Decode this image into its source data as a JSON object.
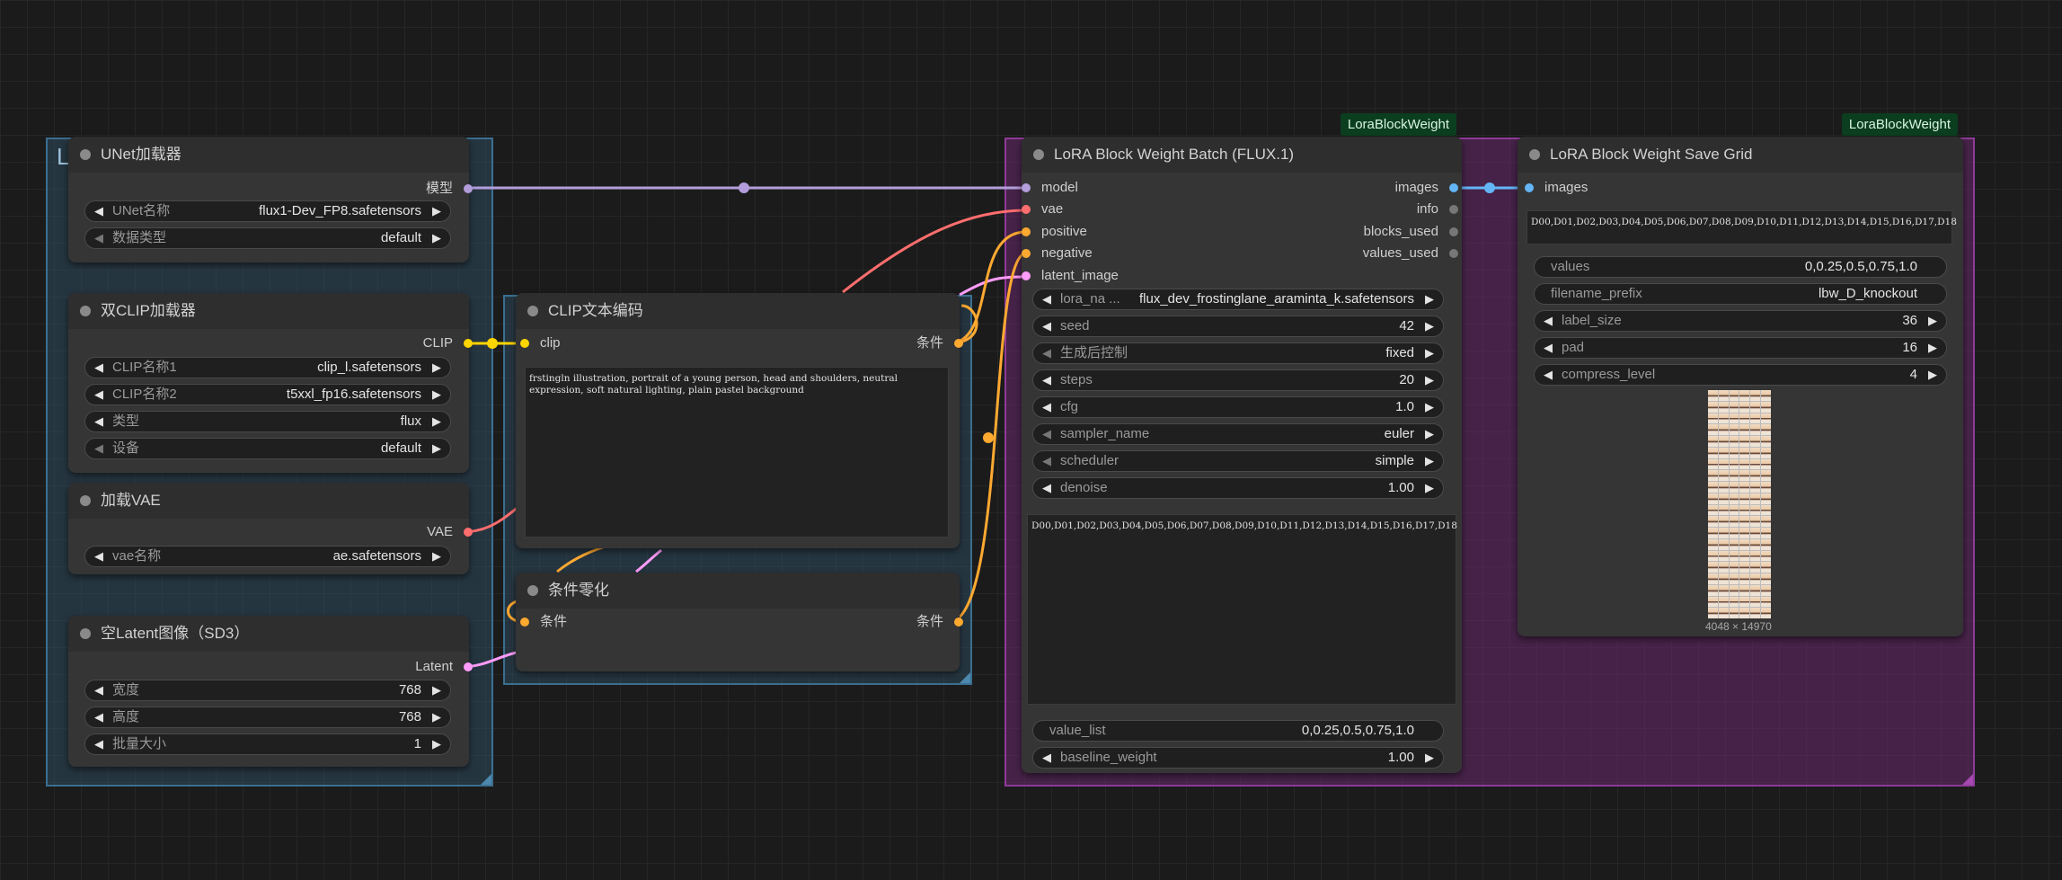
{
  "groups": {
    "left_label": "L"
  },
  "unet_loader": {
    "title": "UNet加载器",
    "out_model": "模型",
    "unet_name": {
      "label": "UNet名称",
      "value": "flux1-Dev_FP8.safetensors"
    },
    "weight_dtype": {
      "label": "数据类型",
      "value": "default"
    }
  },
  "dual_clip": {
    "title": "双CLIP加载器",
    "out_clip": "CLIP",
    "clip_name1": {
      "label": "CLIP名称1",
      "value": "clip_l.safetensors"
    },
    "clip_name2": {
      "label": "CLIP名称2",
      "value": "t5xxl_fp16.safetensors"
    },
    "type": {
      "label": "类型",
      "value": "flux"
    },
    "device": {
      "label": "设备",
      "value": "default"
    }
  },
  "vae_loader": {
    "title": "加载VAE",
    "out_vae": "VAE",
    "vae_name": {
      "label": "vae名称",
      "value": "ae.safetensors"
    }
  },
  "empty_latent": {
    "title": "空Latent图像（SD3）",
    "out_latent": "Latent",
    "width": {
      "label": "宽度",
      "value": "768"
    },
    "height": {
      "label": "高度",
      "value": "768"
    },
    "batch": {
      "label": "批量大小",
      "value": "1"
    }
  },
  "clip_encode": {
    "title": "CLIP文本编码",
    "in_clip": "clip",
    "out_cond": "条件",
    "text": "frstingln illustration, portrait of a young person, head and shoulders, neutral expression, soft natural lighting, plain pastel background"
  },
  "cond_zero": {
    "title": "条件零化",
    "in_cond": "条件",
    "out_cond": "条件"
  },
  "lbw_batch": {
    "badge": "LoraBlockWeight",
    "title": "LoRA Block Weight Batch (FLUX.1)",
    "inputs": [
      "model",
      "vae",
      "positive",
      "negative",
      "latent_image"
    ],
    "outputs": [
      "images",
      "info",
      "blocks_used",
      "values_used"
    ],
    "lora_name": {
      "label": "lora_na ...",
      "value": "flux_dev_frostinglane_araminta_k.safetensors"
    },
    "seed": {
      "label": "seed",
      "value": "42"
    },
    "control": {
      "label": "生成后控制",
      "value": "fixed"
    },
    "steps": {
      "label": "steps",
      "value": "20"
    },
    "cfg": {
      "label": "cfg",
      "value": "1.0"
    },
    "sampler": {
      "label": "sampler_name",
      "value": "euler"
    },
    "scheduler": {
      "label": "scheduler",
      "value": "simple"
    },
    "denoise": {
      "label": "denoise",
      "value": "1.00"
    },
    "blocks_text": "D00,D01,D02,D03,D04,D05,D06,D07,D08,D09,D10,D11,D12,D13,D14,D15,D16,D17,D18",
    "value_list": {
      "label": "value_list",
      "value": "0,0.25,0.5,0.75,1.0"
    },
    "baseline_weight": {
      "label": "baseline_weight",
      "value": "1.00"
    }
  },
  "lbw_save": {
    "badge": "LoraBlockWeight",
    "title": "LoRA Block Weight Save Grid",
    "in_images": "images",
    "blocks_text": "D00,D01,D02,D03,D04,D05,D06,D07,D08,D09,D10,D11,D12,D13,D14,D15,D16,D17,D18",
    "values": {
      "label": "values",
      "value": "0,0.25,0.5,0.75,1.0"
    },
    "filename_prefix": {
      "label": "filename_prefix",
      "value": "lbw_D_knockout"
    },
    "label_size": {
      "label": "label_size",
      "value": "36"
    },
    "pad": {
      "label": "pad",
      "value": "16"
    },
    "compress_level": {
      "label": "compress_level",
      "value": "4"
    },
    "image_size": "4048 × 14970"
  },
  "colors": {
    "model": "#b39ddb",
    "clip": "#ffd500",
    "vae": "#ff6e6e",
    "cond": "#ffa931",
    "latent": "#ff9cf9",
    "image": "#64b5f6"
  }
}
